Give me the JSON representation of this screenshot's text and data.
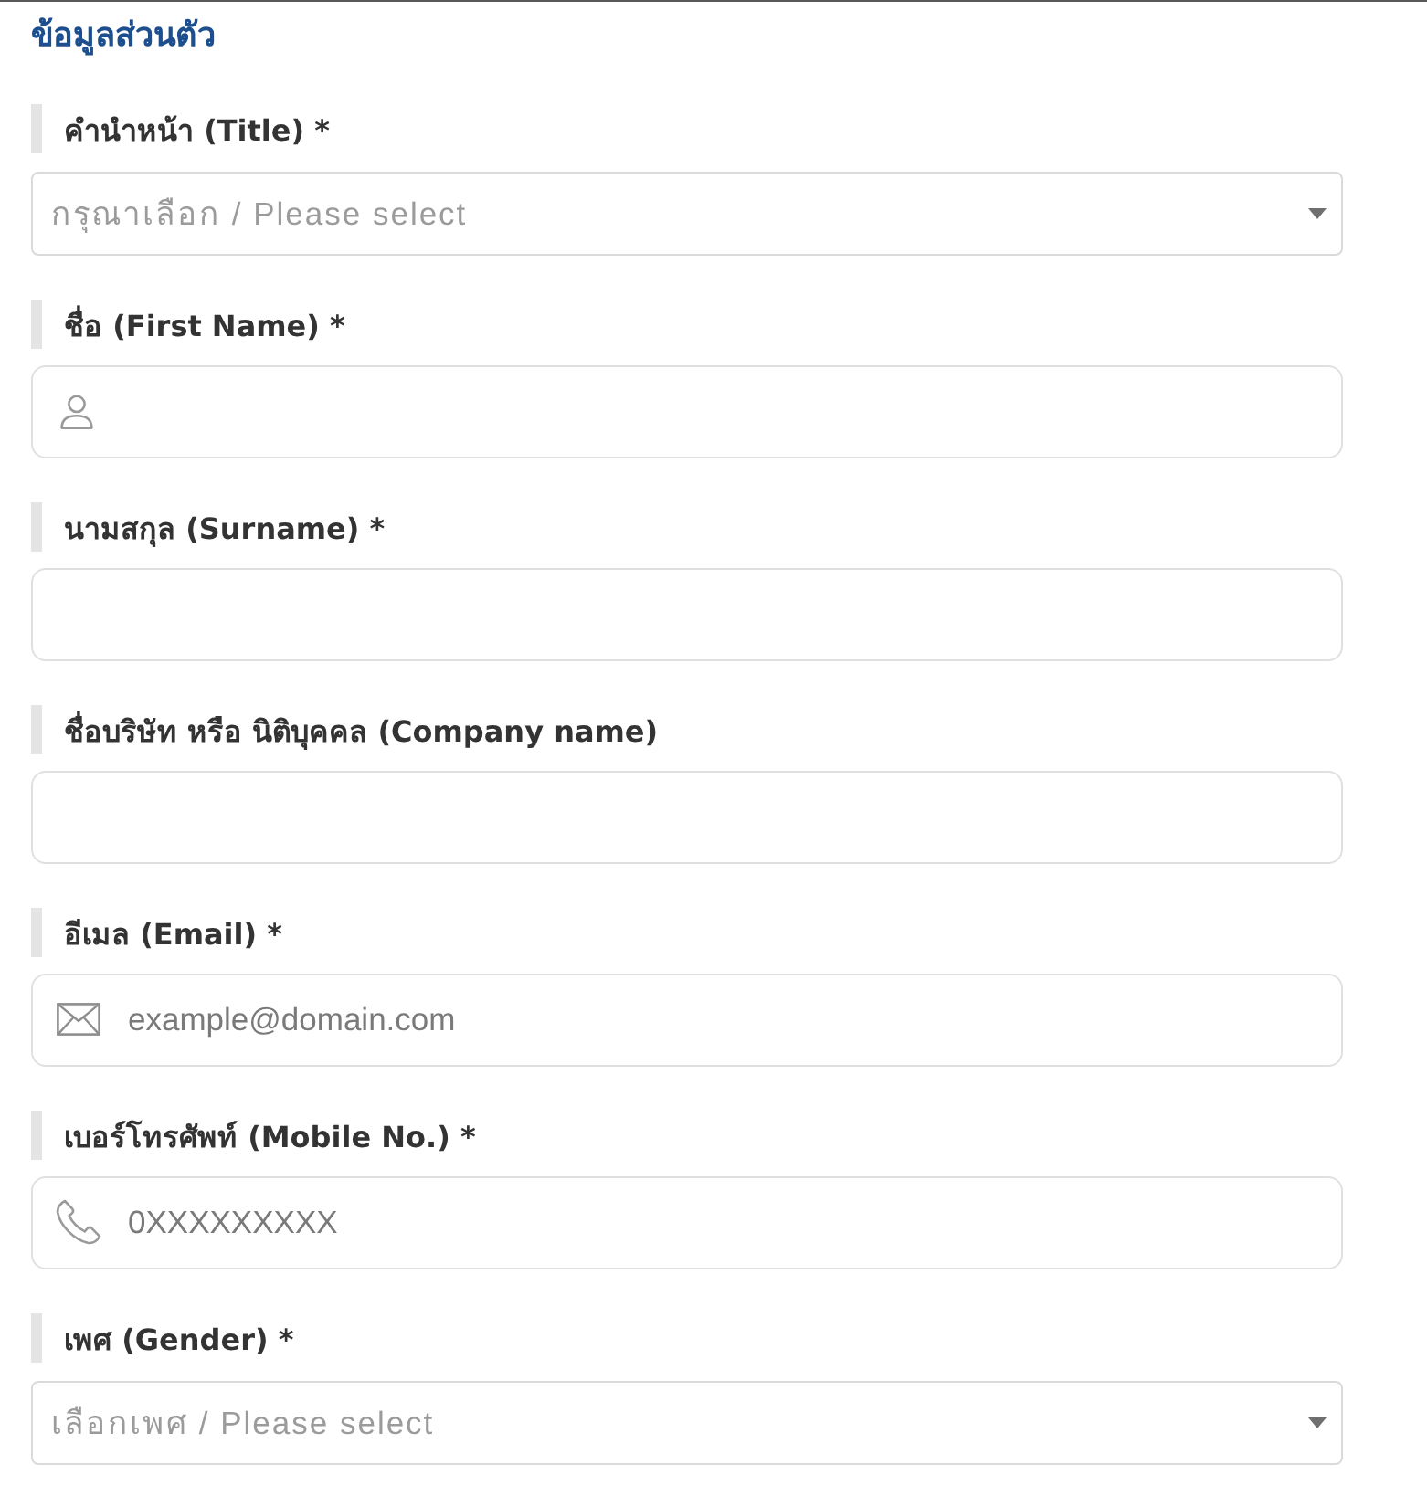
{
  "heading": "ข้อมูลส่วนตัว",
  "fields": [
    {
      "kind": "select",
      "label": "คำนำหน้า (Title) *",
      "placeholder": "กรุณาเลือก / Please select"
    },
    {
      "kind": "name",
      "label": "ชื่อ (First Name) *"
    },
    {
      "kind": "text",
      "label": "นามสกุล (Surname) *"
    },
    {
      "kind": "text",
      "label": "ชื่อบริษัท หรือ นิติบุคคล (Company name)"
    },
    {
      "kind": "email",
      "label": "อีเมล (Email) *",
      "placeholder": "example@domain.com"
    },
    {
      "kind": "tel",
      "label": "เบอร์โทรศัพท์ (Mobile No.) *",
      "placeholder": "0XXXXXXXXX"
    },
    {
      "kind": "select",
      "label": "เพศ (Gender) *",
      "placeholder": "เลือกเพศ / Please select"
    }
  ]
}
